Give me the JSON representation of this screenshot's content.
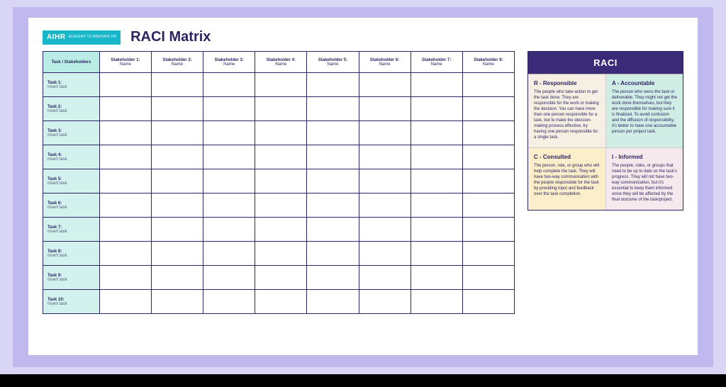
{
  "logo": {
    "main": "AIHR",
    "sub": "ACADEMY TO\nINNOVATE HR"
  },
  "title": "RACI Matrix",
  "matrix": {
    "corner": "Task / Stakeholders",
    "stakeholders": [
      {
        "label": "Stakeholder 1:",
        "name": "Name"
      },
      {
        "label": "Stakeholder 2:",
        "name": "Name"
      },
      {
        "label": "Stakeholder 3:",
        "name": "Name"
      },
      {
        "label": "Stakeholder 4:",
        "name": "Name"
      },
      {
        "label": "Stakeholder 5:",
        "name": "Name"
      },
      {
        "label": "Stakeholder 6:",
        "name": "Name"
      },
      {
        "label": "Stakeholder 7:",
        "name": "Name"
      },
      {
        "label": "Stakeholder 8:",
        "name": "Name"
      }
    ],
    "tasks": [
      {
        "label": "Task 1:",
        "sub": "Insert task"
      },
      {
        "label": "Task 2:",
        "sub": "Insert task"
      },
      {
        "label": "Task 3:",
        "sub": "Insert task"
      },
      {
        "label": "Task 4:",
        "sub": "Insert task"
      },
      {
        "label": "Task 5:",
        "sub": "Insert task"
      },
      {
        "label": "Task 6:",
        "sub": "Insert task"
      },
      {
        "label": "Task 7:",
        "sub": "Insert task"
      },
      {
        "label": "Task 8:",
        "sub": "Insert task"
      },
      {
        "label": "Task 9:",
        "sub": "Insert task"
      },
      {
        "label": "Task 10:",
        "sub": "Insert task"
      }
    ]
  },
  "legend": {
    "title": "RACI",
    "r": {
      "head": "R - Responsible",
      "body": "The people who take action to get the task done. They are responsible for the work or making the decision. You can have more than one person responsible for a task, but to make the decision-making process effective, try having one person responsible for a single task."
    },
    "a": {
      "head": "A - Accountable",
      "body": "The person who owns the task or deliverable. They might not get the work done themselves, but they are responsible for making sure it is finalized. To avoid confusion and the diffusion of responsibility, it's better to have one accountable person per project task."
    },
    "c": {
      "head": "C - Consulted",
      "body": "The person, role, or group who will help complete the task. They will have two-way communication with the people responsible for the task by providing input and feedback over the task completion."
    },
    "i": {
      "head": "I - Informed",
      "body": "The people, roles, or groups that need to be up to date on the task's progress. They will not have two-way communication, but it's essential to keep them informed since they will be affected by the final outcome of the task/project."
    }
  }
}
